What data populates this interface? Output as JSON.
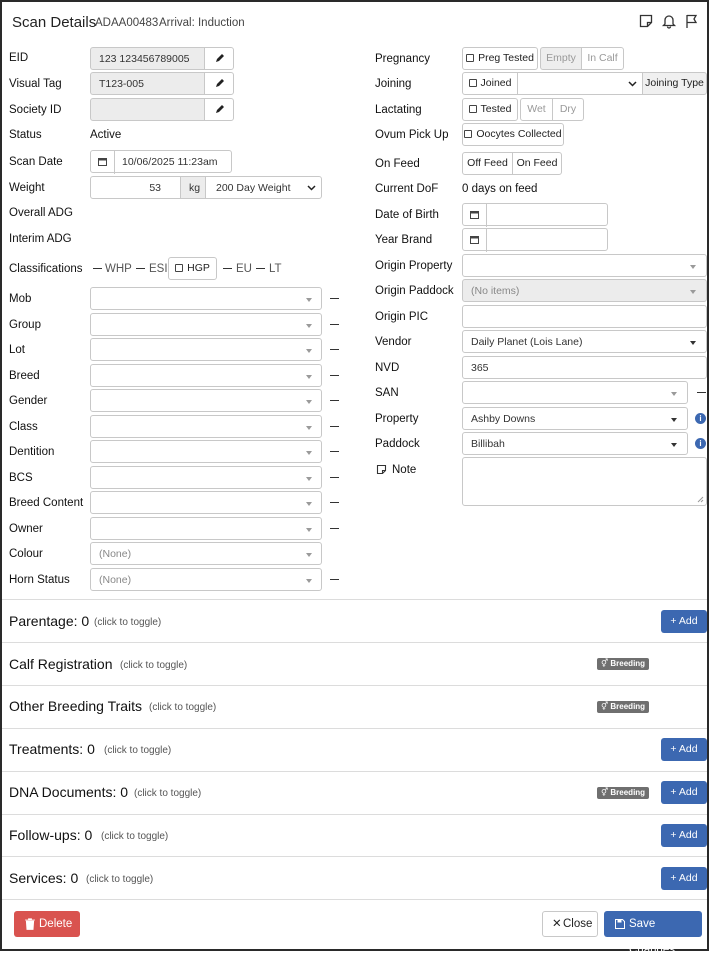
{
  "header": {
    "title": "Scan Details",
    "id": "ADAA00483",
    "arrival": "Arrival: Induction"
  },
  "left": {
    "eid": {
      "label": "EID",
      "value": "123 123456789005"
    },
    "visual_tag": {
      "label": "Visual Tag",
      "value": "T123-005"
    },
    "society_id": {
      "label": "Society ID",
      "value": ""
    },
    "status": {
      "label": "Status",
      "value": "Active"
    },
    "scan_date": {
      "label": "Scan Date",
      "value": "10/06/2025 11:23am"
    },
    "weight": {
      "label": "Weight",
      "value": "53",
      "unit": "kg",
      "type": "200 Day Weight"
    },
    "overall_adg": {
      "label": "Overall ADG"
    },
    "interim_adg": {
      "label": "Interim ADG"
    },
    "classifications": {
      "label": "Classifications",
      "whp": "WHP",
      "esi": "ESI",
      "hgp": "HGP",
      "eu": "EU",
      "lt": "LT"
    },
    "mob": {
      "label": "Mob"
    },
    "group": {
      "label": "Group"
    },
    "lot": {
      "label": "Lot"
    },
    "breed": {
      "label": "Breed"
    },
    "gender": {
      "label": "Gender"
    },
    "class": {
      "label": "Class"
    },
    "dentition": {
      "label": "Dentition"
    },
    "bcs": {
      "label": "BCS"
    },
    "breed_content": {
      "label": "Breed Content"
    },
    "owner": {
      "label": "Owner"
    },
    "colour": {
      "label": "Colour",
      "value": "(None)"
    },
    "horn_status": {
      "label": "Horn Status",
      "value": "(None)"
    }
  },
  "right": {
    "pregnancy": {
      "label": "Pregnancy",
      "check": "Preg Tested",
      "opt1": "Empty",
      "opt2": "In Calf"
    },
    "joining": {
      "label": "Joining",
      "check": "Joined",
      "type_btn": "Joining Type"
    },
    "lactating": {
      "label": "Lactating",
      "check": "Tested",
      "opt1": "Wet",
      "opt2": "Dry"
    },
    "ovum": {
      "label": "Ovum Pick Up",
      "check": "Oocytes Collected"
    },
    "on_feed": {
      "label": "On Feed",
      "opt1": "Off Feed",
      "opt2": "On Feed"
    },
    "current_dof": {
      "label": "Current DoF",
      "value": "0 days on feed"
    },
    "dob": {
      "label": "Date of Birth"
    },
    "year_brand": {
      "label": "Year Brand"
    },
    "origin_property": {
      "label": "Origin Property"
    },
    "origin_paddock": {
      "label": "Origin Paddock",
      "value": "(No items)"
    },
    "origin_pic": {
      "label": "Origin PIC"
    },
    "vendor": {
      "label": "Vendor",
      "value": "Daily Planet (Lois Lane)"
    },
    "nvd": {
      "label": "NVD",
      "value": "365"
    },
    "san": {
      "label": "SAN"
    },
    "property": {
      "label": "Property",
      "value": "Ashby Downs"
    },
    "paddock": {
      "label": "Paddock",
      "value": "Billibah"
    },
    "note": {
      "label": "Note"
    }
  },
  "sections": [
    {
      "title": "Parentage:",
      "count": "0",
      "toggle": "(click to toggle)",
      "add": "+ Add"
    },
    {
      "title": "Calf Registration",
      "toggle": "(click to toggle)",
      "badge": "Breeding"
    },
    {
      "title": "Other Breeding Traits",
      "toggle": "(click to toggle)",
      "badge": "Breeding"
    },
    {
      "title": "Treatments:",
      "count": "0",
      "toggle": "(click to toggle)",
      "add": "+ Add"
    },
    {
      "title": "DNA Documents:",
      "count": "0",
      "toggle": "(click to toggle)",
      "badge": "Breeding",
      "add": "+ Add"
    },
    {
      "title": "Follow-ups:",
      "count": "0",
      "toggle": "(click to toggle)",
      "add": "+ Add"
    },
    {
      "title": "Services:",
      "count": "0",
      "toggle": "(click to toggle)",
      "add": "+ Add"
    }
  ],
  "footer": {
    "delete": "Delete",
    "close": "Close",
    "save": "Save Changes"
  },
  "colors": {
    "primary": "#3c68b1",
    "danger": "#d9534f"
  }
}
